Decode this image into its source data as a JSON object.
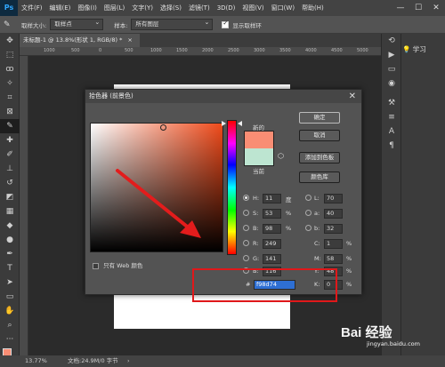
{
  "menubar": {
    "logo": "Ps",
    "items": [
      "文件(F)",
      "编辑(E)",
      "图像(I)",
      "图层(L)",
      "文字(Y)",
      "选择(S)",
      "滤镜(T)",
      "3D(D)",
      "视图(V)",
      "窗口(W)",
      "帮助(H)"
    ],
    "controls": [
      "—",
      "☐",
      "✕"
    ]
  },
  "options": {
    "sample_size_label": "取样大小:",
    "sample_size_value": "取样点",
    "sample_label": "样本:",
    "sample_value": "所有图层",
    "show_ring_label": "显示取样环"
  },
  "document": {
    "tab_title": "未标题-1 @ 13.8%(形状 1, RGB/8) *",
    "tab_close": "×"
  },
  "ruler_ticks": [
    "1000",
    "500",
    "0",
    "500",
    "1000",
    "1500",
    "2000",
    "2500",
    "3000",
    "3500",
    "4000",
    "4500",
    "5000"
  ],
  "right_panel": {
    "learn_label": "学习"
  },
  "status": {
    "zoom": "13.77%",
    "doc_info": "文档:24.9M/0 字节"
  },
  "dialog": {
    "title": "拾色器 (前景色)",
    "close": "✕",
    "new_label": "新的",
    "current_label": "当前",
    "only_web_label": "只有 Web 颜色",
    "buttons": {
      "ok": "确定",
      "cancel": "取消",
      "add_swatch": "添加到色板",
      "color_library": "颜色库"
    },
    "hsb": [
      {
        "label": "H:",
        "value": "11",
        "unit": "度"
      },
      {
        "label": "S:",
        "value": "53",
        "unit": "%"
      },
      {
        "label": "B:",
        "value": "98",
        "unit": "%"
      }
    ],
    "rgb": [
      {
        "label": "R:",
        "value": "249"
      },
      {
        "label": "G:",
        "value": "141"
      },
      {
        "label": "B:",
        "value": "116"
      }
    ],
    "lab": [
      {
        "label": "L:",
        "value": "70"
      },
      {
        "label": "a:",
        "value": "40"
      },
      {
        "label": "b:",
        "value": "32"
      }
    ],
    "cmyk": [
      {
        "label": "C:",
        "value": "1",
        "unit": "%"
      },
      {
        "label": "M:",
        "value": "58",
        "unit": "%"
      },
      {
        "label": "Y:",
        "value": "48",
        "unit": "%"
      },
      {
        "label": "K:",
        "value": "0",
        "unit": "%"
      }
    ],
    "hex_label": "#",
    "hex_value": "f98d74",
    "colors": {
      "new": "#f98d74",
      "current": "#bde5d1",
      "hue_base": "#f04a1a"
    }
  },
  "watermark": {
    "text": "Bai 经验",
    "sub": "jingyan.baidu.com"
  }
}
